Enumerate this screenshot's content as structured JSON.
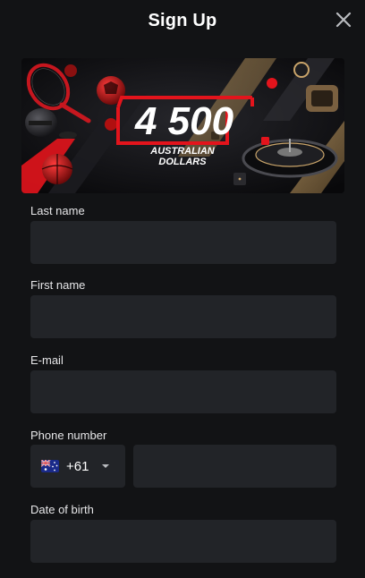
{
  "modal": {
    "title": "Sign Up"
  },
  "banner": {
    "amount": "4 500",
    "currency_line1": "AUSTRALIAN",
    "currency_line2": "DOLLARS",
    "accent_color": "#e3141c"
  },
  "fields": {
    "last_name": {
      "label": "Last name",
      "value": "",
      "placeholder": ""
    },
    "first_name": {
      "label": "First name",
      "value": "",
      "placeholder": ""
    },
    "email": {
      "label": "E-mail",
      "value": "",
      "placeholder": ""
    },
    "phone": {
      "label": "Phone number",
      "country_code": "+61",
      "country_flag_icon": "australia-flag-icon",
      "value": "",
      "placeholder": ""
    },
    "dob": {
      "label": "Date of birth",
      "value": "",
      "placeholder": ""
    }
  },
  "colors": {
    "background": "#121315",
    "input_background": "#222428",
    "text": "#ffffff",
    "label": "#e6e6e8"
  }
}
